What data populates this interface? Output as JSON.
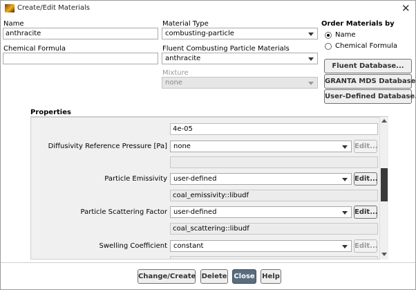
{
  "window": {
    "title": "Create/Edit Materials"
  },
  "name": {
    "label": "Name",
    "value": "anthracite"
  },
  "chemical_formula": {
    "label": "Chemical Formula",
    "value": ""
  },
  "material_type": {
    "label": "Material Type",
    "value": "combusting-particle"
  },
  "fluent_materials": {
    "label": "Fluent Combusting Particle Materials",
    "value": "anthracite"
  },
  "mixture": {
    "label": "Mixture",
    "value": "none"
  },
  "order_by": {
    "label": "Order Materials by",
    "options": [
      "Name",
      "Chemical Formula"
    ],
    "selected": "Name"
  },
  "database_buttons": {
    "fluent": "Fluent Database...",
    "granta": "GRANTA MDS Database...",
    "user_defined": "User-Defined Database..."
  },
  "properties": {
    "title": "Properties",
    "top_value": "4e-05",
    "rows": [
      {
        "label": "Diffusivity Reference Pressure [Pa]",
        "value": "none",
        "edit": "Edit...",
        "edit_enabled": false,
        "sub": ""
      },
      {
        "label": "Particle Emissivity",
        "value": "user-defined",
        "edit": "Edit...",
        "edit_enabled": true,
        "sub": "coal_emissivity::libudf"
      },
      {
        "label": "Particle Scattering Factor",
        "value": "user-defined",
        "edit": "Edit...",
        "edit_enabled": true,
        "sub": "coal_scattering::libudf"
      },
      {
        "label": "Swelling Coefficient",
        "value": "constant",
        "edit": "Edit...",
        "edit_enabled": false
      }
    ]
  },
  "footer": {
    "change_create": "Change/Create",
    "delete": "Delete",
    "close": "Close",
    "help": "Help"
  },
  "colors": {
    "primary_button": "#596d7f",
    "scroll_thumb": "#3a3a3a"
  }
}
